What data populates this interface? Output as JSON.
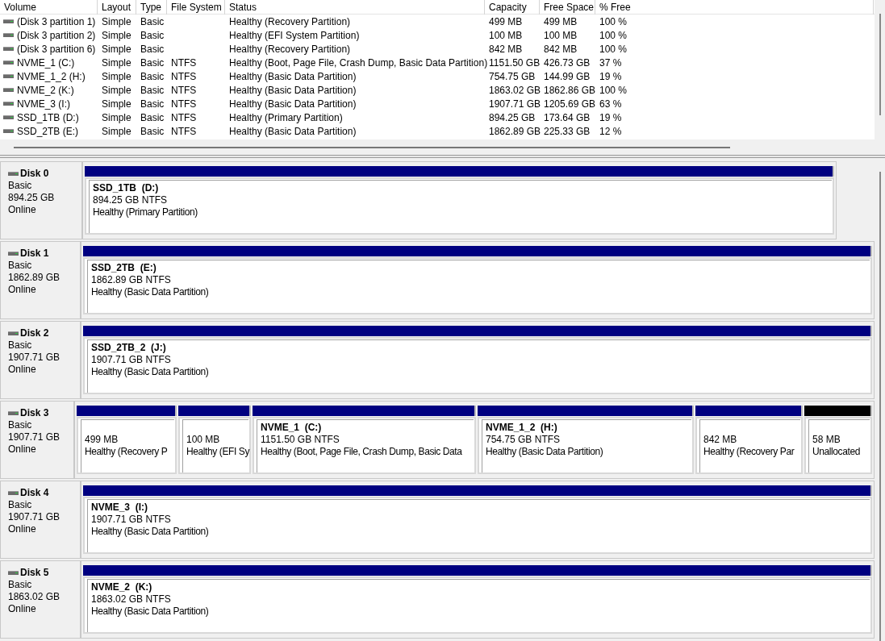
{
  "volume_table": {
    "columns": [
      "Volume",
      "Layout",
      "Type",
      "File System",
      "Status",
      "Capacity",
      "Free Space",
      "% Free"
    ],
    "rows": [
      [
        "(Disk 3 partition 1)",
        "Simple",
        "Basic",
        "",
        "Healthy (Recovery Partition)",
        "499 MB",
        "499 MB",
        "100 %"
      ],
      [
        "(Disk 3 partition 2)",
        "Simple",
        "Basic",
        "",
        "Healthy (EFI System Partition)",
        "100 MB",
        "100 MB",
        "100 %"
      ],
      [
        "(Disk 3 partition 6)",
        "Simple",
        "Basic",
        "",
        "Healthy (Recovery Partition)",
        "842 MB",
        "842 MB",
        "100 %"
      ],
      [
        "NVME_1 (C:)",
        "Simple",
        "Basic",
        "NTFS",
        "Healthy (Boot, Page File, Crash Dump, Basic Data Partition)",
        "1151.50 GB",
        "426.73 GB",
        "37 %"
      ],
      [
        "NVME_1_2 (H:)",
        "Simple",
        "Basic",
        "NTFS",
        "Healthy (Basic Data Partition)",
        "754.75 GB",
        "144.99 GB",
        "19 %"
      ],
      [
        "NVME_2 (K:)",
        "Simple",
        "Basic",
        "NTFS",
        "Healthy (Basic Data Partition)",
        "1863.02 GB",
        "1862.86 GB",
        "100 %"
      ],
      [
        "NVME_3 (I:)",
        "Simple",
        "Basic",
        "NTFS",
        "Healthy (Basic Data Partition)",
        "1907.71 GB",
        "1205.69 GB",
        "63 %"
      ],
      [
        "SSD_1TB (D:)",
        "Simple",
        "Basic",
        "NTFS",
        "Healthy (Primary Partition)",
        "894.25 GB",
        "173.64 GB",
        "19 %"
      ],
      [
        "SSD_2TB (E:)",
        "Simple",
        "Basic",
        "NTFS",
        "Healthy (Basic Data Partition)",
        "1862.89 GB",
        "225.33 GB",
        "12 %"
      ]
    ]
  },
  "disks": [
    {
      "name": "Disk 0",
      "type": "Basic",
      "size": "894.25 GB",
      "state": "Online",
      "partitions": [
        {
          "kind": "primary",
          "name": "SSD_1TB  (D:)",
          "size": "894.25 GB NTFS",
          "status": "Healthy (Primary Partition)"
        }
      ]
    },
    {
      "name": "Disk 1",
      "type": "Basic",
      "size": "1862.89 GB",
      "state": "Online",
      "partitions": [
        {
          "kind": "primary",
          "name": "SSD_2TB  (E:)",
          "size": "1862.89 GB NTFS",
          "status": "Healthy (Basic Data Partition)"
        }
      ]
    },
    {
      "name": "Disk 2",
      "type": "Basic",
      "size": "1907.71 GB",
      "state": "Online",
      "partitions": [
        {
          "kind": "primary",
          "name": "SSD_2TB_2  (J:)",
          "size": "1907.71 GB NTFS",
          "status": "Healthy (Basic Data Partition)"
        }
      ]
    },
    {
      "name": "Disk 3",
      "type": "Basic",
      "size": "1907.71 GB",
      "state": "Online",
      "partitions": [
        {
          "kind": "primary",
          "size": "499 MB",
          "status": "Healthy (Recovery P"
        },
        {
          "kind": "primary",
          "size": "100 MB",
          "status": "Healthy (EFI Sy"
        },
        {
          "kind": "primary",
          "name": "NVME_1  (C:)",
          "size": "1151.50 GB NTFS",
          "status": "Healthy (Boot, Page File, Crash Dump, Basic Data"
        },
        {
          "kind": "primary",
          "name": "NVME_1_2  (H:)",
          "size": "754.75 GB NTFS",
          "status": "Healthy (Basic Data Partition)"
        },
        {
          "kind": "primary",
          "size": "842 MB",
          "status": "Healthy (Recovery Par"
        },
        {
          "kind": "unallocated",
          "size": "58 MB",
          "status": "Unallocated"
        }
      ]
    },
    {
      "name": "Disk 4",
      "type": "Basic",
      "size": "1907.71 GB",
      "state": "Online",
      "partitions": [
        {
          "kind": "primary",
          "name": "NVME_3  (I:)",
          "size": "1907.71 GB NTFS",
          "status": "Healthy (Basic Data Partition)"
        }
      ]
    },
    {
      "name": "Disk 5",
      "type": "Basic",
      "size": "1863.02 GB",
      "state": "Online",
      "partitions": [
        {
          "kind": "primary",
          "name": "NVME_2  (K:)",
          "size": "1863.02 GB NTFS",
          "status": "Healthy (Basic Data Partition)"
        }
      ]
    }
  ]
}
